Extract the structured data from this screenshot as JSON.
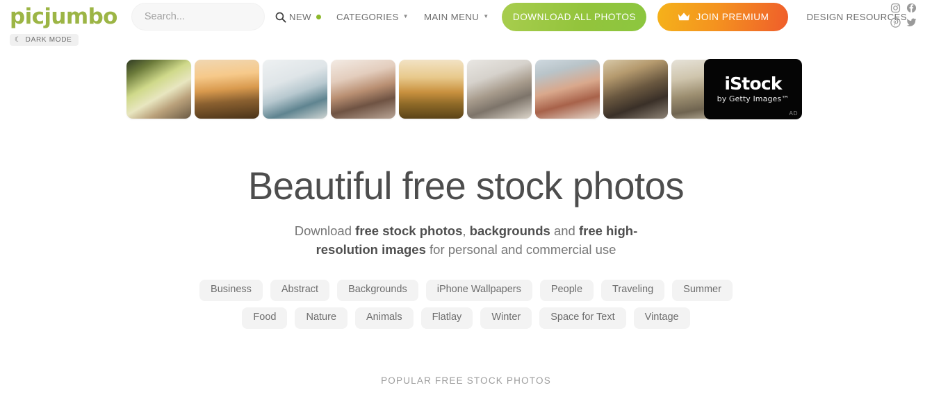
{
  "header": {
    "logo": "picjumbo",
    "search": {
      "placeholder": "Search...",
      "value": "",
      "icon": "search-icon"
    },
    "nav": [
      {
        "label": "NEW",
        "dot": true,
        "caret": false
      },
      {
        "label": "CATEGORIES",
        "dot": false,
        "caret": "▼"
      },
      {
        "label": "MAIN MENU",
        "dot": false,
        "caret": "▼"
      }
    ],
    "download_button": "DOWNLOAD ALL PHOTOS",
    "premium_button": "JOIN PREMIUM",
    "premium_icon": "crown-icon",
    "design_resources": "DESIGN RESOURCES",
    "socials": [
      {
        "name": "instagram-icon"
      },
      {
        "name": "facebook-icon"
      },
      {
        "name": "pinterest-icon"
      },
      {
        "name": "twitter-icon"
      }
    ],
    "dark_mode": {
      "label": "DARK MODE",
      "icon": "moon-icon",
      "glyph": "☾"
    },
    "colors": {
      "logo_green": "#9cb545",
      "download_green": "#8cc63f",
      "premium_orange_start": "#f5b21a",
      "premium_orange_end": "#ef5d2b",
      "new_dot_green": "#8cb82b"
    }
  },
  "thumbnails": [
    {
      "name": "family-autumn-park"
    },
    {
      "name": "couple-sunset-field"
    },
    {
      "name": "family-living-room-heart"
    },
    {
      "name": "family-piggyback-selfie"
    },
    {
      "name": "family-running-field-sunset"
    },
    {
      "name": "family-house-frame-floor"
    },
    {
      "name": "family-four-outdoors-smiling"
    },
    {
      "name": "friends-kitchen-table"
    },
    {
      "name": "family-walking-dunes"
    }
  ],
  "ad": {
    "title": "iStock",
    "subtitle": "by Getty Images™",
    "badge": "AD"
  },
  "hero": {
    "title": "Beautiful free stock photos",
    "subtitle_parts": [
      {
        "text": "Download ",
        "bold": false
      },
      {
        "text": "free stock photos",
        "bold": true
      },
      {
        "text": ", ",
        "bold": false
      },
      {
        "text": "backgrounds",
        "bold": true
      },
      {
        "text": " and ",
        "bold": false
      },
      {
        "text": "free high-resolution images",
        "bold": true
      },
      {
        "text": " for personal and commercial use",
        "bold": false
      }
    ]
  },
  "tags": [
    "Business",
    "Abstract",
    "Backgrounds",
    "iPhone Wallpapers",
    "People",
    "Traveling",
    "Summer",
    "Food",
    "Nature",
    "Animals",
    "Flatlay",
    "Winter",
    "Space for Text",
    "Vintage"
  ],
  "section_title": "POPULAR FREE STOCK PHOTOS"
}
